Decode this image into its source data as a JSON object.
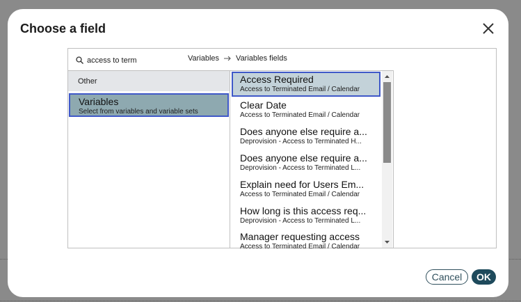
{
  "dialog": {
    "title": "Choose a field",
    "close_icon": "close-icon"
  },
  "search": {
    "value": "access to term",
    "icon": "search-icon"
  },
  "breadcrumb": {
    "items": [
      "Variables",
      "Variables fields"
    ],
    "separator_icon": "arrow-right-icon"
  },
  "categories": {
    "header": "Other",
    "items": [
      {
        "label": "Variables",
        "sublabel": "Select from variables and variable sets",
        "selected": true
      }
    ]
  },
  "fields": {
    "items": [
      {
        "label": "Access Required",
        "sublabel": "Access to Terminated Email / Calendar",
        "selected": true
      },
      {
        "label": "Clear Date",
        "sublabel": "Access to Terminated Email / Calendar"
      },
      {
        "label": "Does anyone else require a...",
        "sublabel": "Deprovision - Access to Terminated H..."
      },
      {
        "label": "Does anyone else require a...",
        "sublabel": "Deprovision - Access to Terminated L..."
      },
      {
        "label": "Explain need for Users Em...",
        "sublabel": "Access to Terminated Email / Calendar"
      },
      {
        "label": "How long is this access req...",
        "sublabel": "Deprovision - Access to Terminated L..."
      },
      {
        "label": "Manager requesting access",
        "sublabel": "Access to Terminated Email / Calendar"
      }
    ]
  },
  "footer": {
    "cancel_label": "Cancel",
    "ok_label": "OK"
  },
  "colors": {
    "accent": "#3f58c8",
    "primary_button": "#1e4a5c",
    "selected_category": "#8ea9b0",
    "selected_field": "#c3d2d9"
  }
}
